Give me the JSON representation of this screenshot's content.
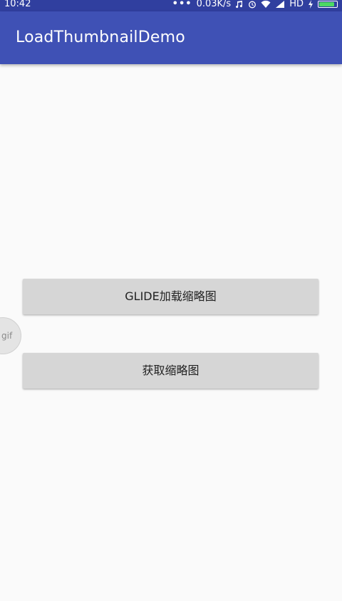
{
  "status_bar": {
    "time": "10:42",
    "dots": "•••",
    "net_speed": "0.03K/s",
    "hd_label": "HD",
    "icons": [
      "music-note-icon",
      "alarm-icon",
      "wifi-icon",
      "signal-icon",
      "charging-bolt-icon",
      "battery-icon"
    ],
    "battery_level": 0.9,
    "battery_color": "#4cd964"
  },
  "app_bar": {
    "title": "LoadThumbnailDemo",
    "color": "#3f51b5",
    "status_color": "#303f9f"
  },
  "buttons": {
    "glide_load": "GLIDE加载缩略图",
    "get_thumbnail": "获取缩略图"
  },
  "overlay": {
    "gif_label": "gif"
  }
}
